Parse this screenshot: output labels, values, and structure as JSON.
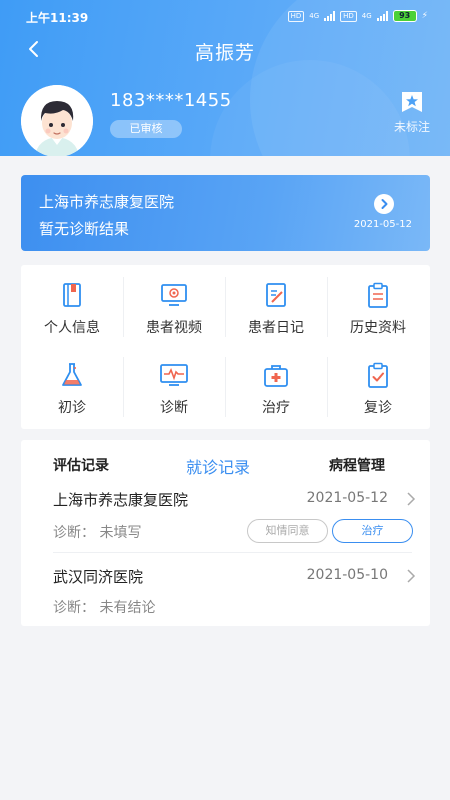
{
  "status_bar": {
    "time": "上午11:39",
    "tag_hd1": "HD",
    "tag_4g1": "4G",
    "tag_hd2": "HD",
    "tag_4g2": "4G",
    "battery": "93"
  },
  "header": {
    "title": "高振芳",
    "phone": "183****1455",
    "audit_badge": "已审核",
    "mark_label": "未标注"
  },
  "banner": {
    "hospital": "上海市养志康复医院",
    "result": "暂无诊断结果",
    "date": "2021-05-12"
  },
  "grid": {
    "personal_info": "个人信息",
    "patient_video": "患者视频",
    "patient_diary": "患者日记",
    "history": "历史资料",
    "first_visit": "初诊",
    "diagnosis": "诊断",
    "treatment": "治疗",
    "follow_up": "复诊"
  },
  "tabs": {
    "assessment": "评估记录",
    "visits": "就诊记录",
    "course": "病程管理",
    "active": "就诊记录"
  },
  "records": [
    {
      "hospital": "上海市养志康复医院",
      "date": "2021-05-12",
      "diagnosis": "诊断：  未填写",
      "consent": "知情同意",
      "treatment": "治疗"
    },
    {
      "hospital": "武汉同济医院",
      "date": "2021-05-10",
      "diagnosis": "诊断：  未有结论"
    }
  ],
  "colors": {
    "accent": "#3a8ef0",
    "header_start": "#3f9cf6",
    "header_end": "#6fb4f7"
  },
  "icons": {
    "back": "chevron-left-icon",
    "mark": "bookmark-star-icon",
    "banner_arrow": "chevron-right-circle-icon"
  }
}
